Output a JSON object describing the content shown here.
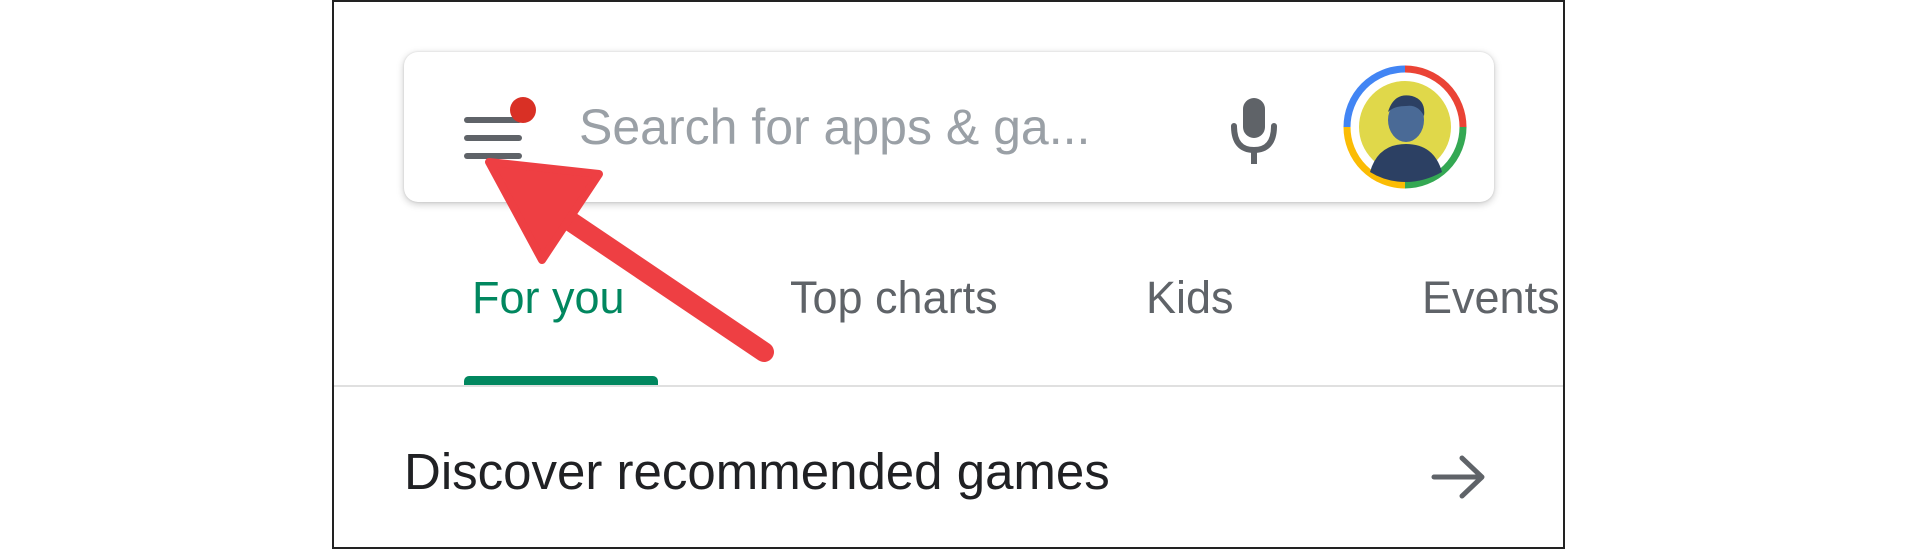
{
  "search": {
    "placeholder": "Search for apps & ga...",
    "menu_icon": "hamburger-menu-icon",
    "notification_dot_color": "#d93025",
    "mic_icon": "microphone-icon",
    "avatar_icon": "account-avatar"
  },
  "tabs": [
    {
      "label": "For you",
      "active": true
    },
    {
      "label": "Top charts",
      "active": false
    },
    {
      "label": "Kids",
      "active": false
    },
    {
      "label": "Events",
      "active": false
    }
  ],
  "section": {
    "title": "Discover recommended games",
    "arrow_icon": "arrow-right-icon"
  },
  "annotation": {
    "arrow_color": "#ee3f43",
    "points_to": "hamburger-menu-icon"
  },
  "colors": {
    "accent": "#01875f",
    "icon_gray": "#5f6368",
    "placeholder_gray": "#9aa0a6",
    "text": "#202124"
  }
}
